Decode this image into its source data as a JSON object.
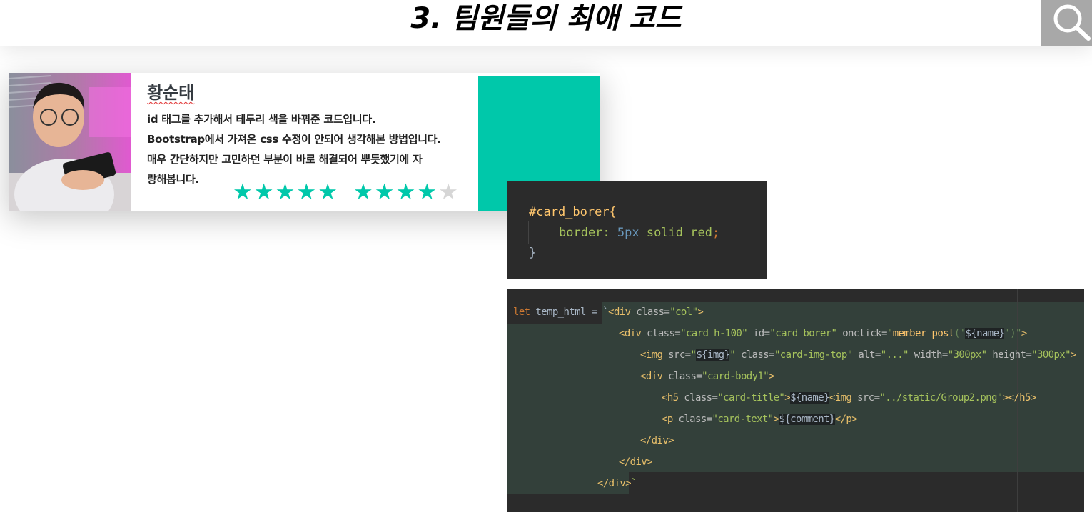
{
  "header": {
    "title": "3. 팀원들의 최애 코드",
    "search_icon": "search-icon"
  },
  "member_card": {
    "name": "황순태",
    "comment_lines": [
      "id 태그를 추가해서 테두리 색을 바꿔준 코드입니다.",
      "Bootstrap에서 가져온 css 수정이 안되어 생각해본 방법입니다.",
      "매우 간단하지만 고민하던 부분이 바로 해결되어 뿌듯했기에 자",
      "랑해봅니다."
    ],
    "rating_1": 5,
    "rating_2": 4,
    "accent_color": "#00c8aa"
  },
  "code_css": {
    "line1": "#card_borer{",
    "line2_prop": "border: ",
    "line2_num": "5px",
    "line2_rest": " solid red",
    "line2_end": ";",
    "line3": "}"
  },
  "code_js": {
    "l1_kw": "let",
    "l1_var": " temp_html = `",
    "l1_tag": "<div",
    "l1_attr": " class=",
    "l1_str": "\"col\"",
    "l1_end": ">",
    "l2_tag": "<div",
    "l2_attr1": " class=",
    "l2_str1": "\"card h-100\"",
    "l2_attr2": " id=",
    "l2_str2": "\"card_borer\"",
    "l2_attr3": " onclick=",
    "l2_q": "\"",
    "l2_fn": "member_post",
    "l2_p": "('",
    "l2_tpl": "${name}",
    "l2_p2": "')\"",
    "l2_end": ">",
    "l3_tag": "<img",
    "l3_attr1": " src=",
    "l3_q1": "\"",
    "l3_tpl": "${img}",
    "l3_q2": "\"",
    "l3_attr2": " class=",
    "l3_str2": "\"card-img-top\"",
    "l3_attr3": " alt=",
    "l3_str3": "\"...\"",
    "l3_attr4": " width=",
    "l3_str4": "\"300px\"",
    "l3_attr5": " height=",
    "l3_str5": "\"300px\"",
    "l3_end": ">",
    "l4_tag": "<div",
    "l4_attr": " class=",
    "l4_str": "\"card-body1\"",
    "l4_end": ">",
    "l5_tag": "<h5",
    "l5_attr": " class=",
    "l5_str": "\"card-title\"",
    "l5_gt": ">",
    "l5_tpl": "${name}",
    "l5_tag2": "<img",
    "l5_attr2": " src=",
    "l5_str2": "\"../static/Group2.png\"",
    "l5_close": "></h5>",
    "l6_tag": "<p",
    "l6_attr": " class=",
    "l6_str": "\"card-text\"",
    "l6_gt": ">",
    "l6_tpl": "${comment}",
    "l6_close": "</p>",
    "l7": "</div>",
    "l8": "</div>",
    "l9": "</div>",
    "l9_tick": "`"
  }
}
